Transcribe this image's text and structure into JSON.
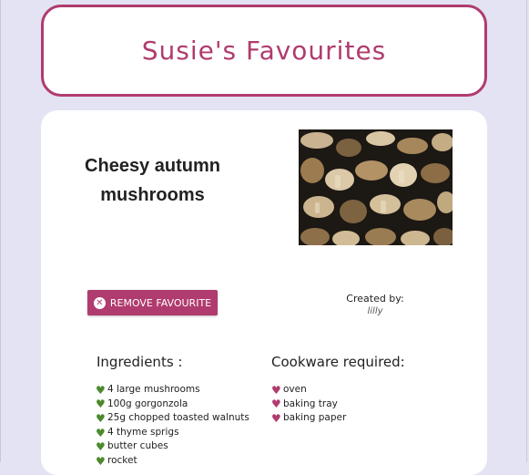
{
  "site": {
    "title": "Susie's Favourites"
  },
  "recipe": {
    "title_line1": "Cheesy autumn",
    "title_line2": "mushrooms",
    "remove_label": "REMOVE FAVOURITE",
    "created_by_label": "Created by:",
    "created_by_user": "lilly"
  },
  "ingredients": {
    "heading": "Ingredients :",
    "items": [
      "4 large mushrooms",
      "100g gorgonzola",
      "25g chopped toasted walnuts",
      "4 thyme sprigs",
      "butter cubes",
      "rocket"
    ]
  },
  "cookware": {
    "heading": "Cookware required:",
    "items": [
      "oven",
      "baking tray",
      "baking paper"
    ]
  },
  "colors": {
    "accent": "#b03b6e",
    "ingredient_heart": "#4b8a2c",
    "background": "#e3e3f3"
  }
}
